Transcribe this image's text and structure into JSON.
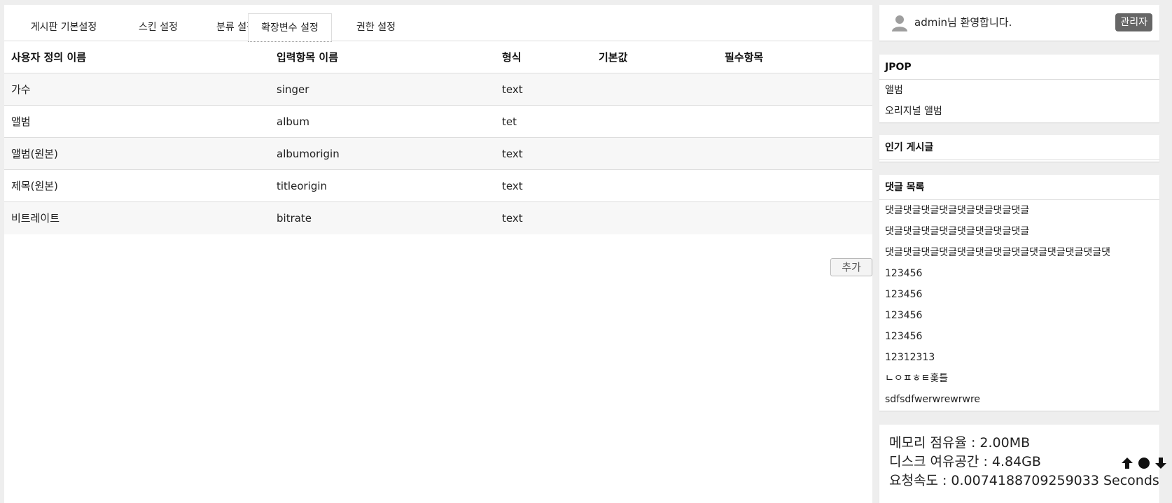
{
  "tabs": [
    {
      "label": "게시판 기본설정"
    },
    {
      "label": "스킨 설정"
    },
    {
      "label": "분류 설정"
    },
    {
      "label": "확장변수 설정",
      "active": true
    },
    {
      "label": "권한 설정"
    }
  ],
  "table": {
    "headers": [
      "사용자 정의 이름",
      "입력항목 이름",
      "형식",
      "기본값",
      "필수항목"
    ],
    "rows": [
      [
        "가수",
        "singer",
        "text",
        "",
        ""
      ],
      [
        "앨범",
        "album",
        "tet",
        "",
        ""
      ],
      [
        "앨범(원본)",
        "albumorigin",
        "text",
        "",
        ""
      ],
      [
        "제목(원본)",
        "titleorigin",
        "text",
        "",
        ""
      ],
      [
        "비트레이트",
        "bitrate",
        "text",
        "",
        ""
      ]
    ]
  },
  "add_button": "추가",
  "user": {
    "greeting": "admin님 환영합니다.",
    "admin_button": "관리자",
    "icon": "user-icon"
  },
  "category": {
    "title": "JPOP",
    "items": [
      "앨범",
      "오리지널 앨범"
    ]
  },
  "popular": {
    "title": "인기 게시글"
  },
  "comments": {
    "title": "댓글 목록",
    "items": [
      "댓글댓글댓글댓글댓글댓글댓글댓글",
      "댓글댓글댓글댓글댓글댓글댓글댓글",
      "댓글댓글댓글댓글댓글댓글댓글댓글댓글댓글댓글댓글댓",
      "123456",
      "123456",
      "123456",
      "123456",
      "12312313",
      "ㄴㅇㅍㅎㅌ홏틀",
      "sdfsdfwerwrewrwre"
    ]
  },
  "stats": {
    "memory": "메모리 점유율 : 2.00MB",
    "disk": "디스크 여유공간 : 4.84GB",
    "speed": "요청속도 : 0.0074188709259033 Seconds"
  },
  "nav_icons": [
    "arrow-up-icon",
    "dot-icon",
    "arrow-down-icon"
  ]
}
